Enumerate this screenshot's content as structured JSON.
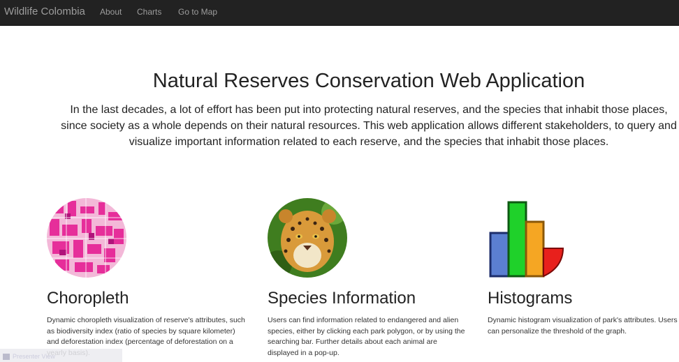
{
  "navbar": {
    "brand": "Wildlife Colombia",
    "links": [
      "About",
      "Charts",
      "Go to Map"
    ]
  },
  "hero": {
    "title": "Natural Reserves Conservation Web Application",
    "lead": "In the last decades, a lot of effort has been put into protecting natural reserves, and the species that inhabit those places, since society as a whole depends on their natural resources. This web application allows different stakeholders, to query and visualize important information related to each reserve, and the species that inhabit those places."
  },
  "features": [
    {
      "icon": "choropleth-map-icon",
      "title": "Choropleth",
      "text": "Dynamic choropleth visualization of reserve's attributes, such as biodiversity index (ratio of species by square kilometer) and deforestation index (percentage of deforestation on a yearly basis)."
    },
    {
      "icon": "jaguar-icon",
      "title": "Species Information",
      "text": "Users can find information related to endangered and alien species, either by clicking each park polygon, or by using the searching bar. Further details about each animal are displayed in a pop-up."
    },
    {
      "icon": "histogram-chart-icon",
      "title": "Histograms",
      "text": "Dynamic histogram visualization of park's attributes. Users can personalize the threshold of the graph."
    }
  ],
  "overlay": {
    "presenter_label": "Presenter View"
  },
  "colors": {
    "navbar_bg": "#222222",
    "nav_text": "#9d9d9d",
    "choropleth_pink": "#e62e9a",
    "bar_blue": "#5b7fd1",
    "bar_green": "#1fd12a",
    "bar_orange": "#f5a623",
    "bar_red": "#e8201c"
  }
}
